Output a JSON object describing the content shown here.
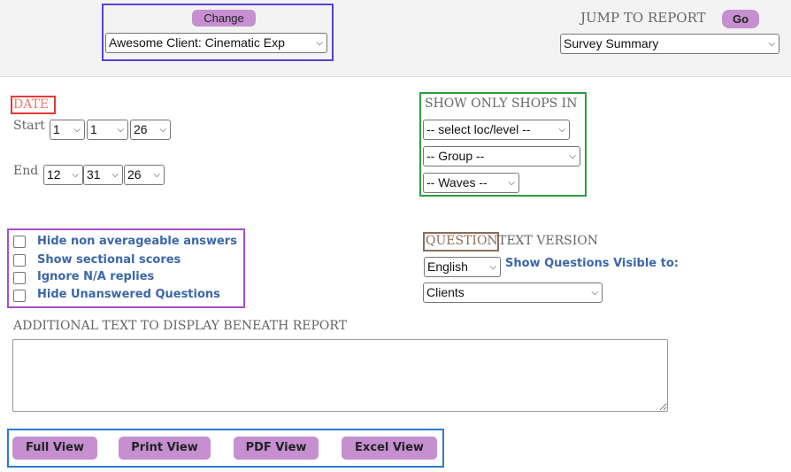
{
  "client": {
    "change_label": "Change",
    "selected": "Awesome Client: Cinematic Exp"
  },
  "jump": {
    "label": "JUMP TO REPORT",
    "go_label": "Go",
    "selected": "Survey Summary"
  },
  "date": {
    "title": "DATE",
    "start_label": "Start",
    "start_month": "1",
    "start_day": "1",
    "start_year": "26",
    "end_label": "End",
    "end_month": "12",
    "end_day": "31",
    "end_year": "26"
  },
  "shops": {
    "title": "SHOW ONLY SHOPS IN",
    "loc": "-- select loc/level --",
    "group": "-- Group --",
    "waves": "-- Waves --"
  },
  "options": [
    {
      "label": "Hide non averageable answers",
      "checked": false
    },
    {
      "label": "Show sectional scores",
      "checked": false
    },
    {
      "label": "Ignore N/A replies",
      "checked": false
    },
    {
      "label": "Hide Unanswered Questions",
      "checked": false
    }
  ],
  "question": {
    "title_part1": "QUESTION",
    "title_part2": " TEXT VERSION",
    "language": "English",
    "visible_label": "Show Questions Visible to:",
    "visible_to": "Clients"
  },
  "additional": {
    "label": "ADDITIONAL TEXT TO DISPLAY BENEATH REPORT",
    "value": ""
  },
  "views": {
    "full": "Full View",
    "print": "Print View",
    "pdf": "PDF View",
    "excel": "Excel View"
  },
  "colors": {
    "accent": "#c58fd0",
    "link": "#3b67a8",
    "box_client": "#5b3fd6",
    "box_date": "#e53935",
    "box_shops": "#2e9e3e",
    "box_options": "#a64ec8",
    "box_question": "#8a6d5a",
    "box_views": "#2f7ad1"
  }
}
